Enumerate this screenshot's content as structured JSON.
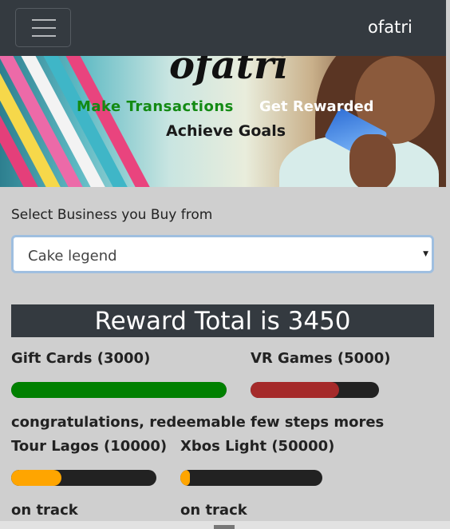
{
  "navbar": {
    "brand": "ofatri"
  },
  "hero": {
    "logo_text": "ofatri",
    "tagline_1": "Make Transactions",
    "tagline_2": "Get Rewarded",
    "tagline_3": "Achieve Goals"
  },
  "form": {
    "select_label": "Select Business you Buy from",
    "selected_business": "Cake legend",
    "caret": "▼"
  },
  "reward_total": "Reward Total is 3450",
  "rewards": [
    {
      "name": "Gift Cards (3000)",
      "status": "congratulations, redeemable",
      "progress": 1.0,
      "color": "#008000"
    },
    {
      "name": "VR Games (5000)",
      "status": "few steps mores",
      "progress": 0.69,
      "color": "#a52a2a"
    },
    {
      "name": "Tour Lagos (10000)",
      "status": "on track",
      "progress": 0.345,
      "color": "#ffa500"
    },
    {
      "name": "Xbos Light (50000)",
      "status": "on track",
      "progress": 0.069,
      "color": "#ffa500"
    }
  ]
}
